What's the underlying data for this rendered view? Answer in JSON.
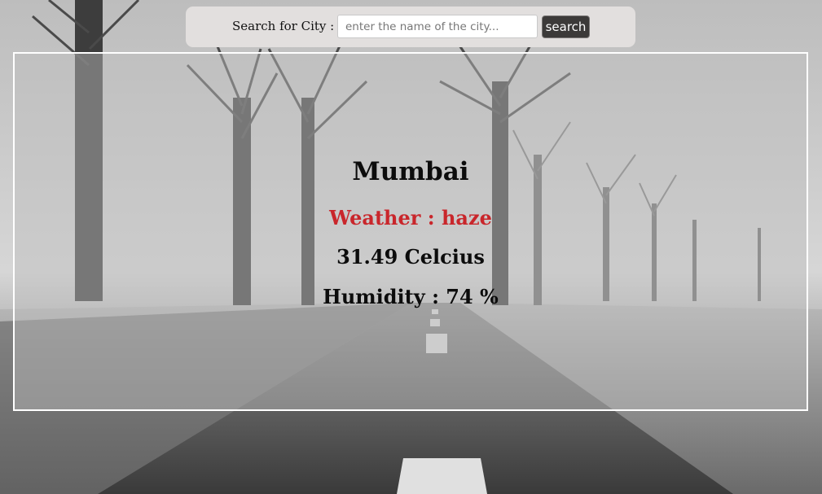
{
  "search": {
    "label": "Search for City :",
    "placeholder": "enter the name of the city...",
    "value": "",
    "button_label": "search"
  },
  "weather_card": {
    "city": "Mumbai",
    "weather": "Weather : haze",
    "temperature": "31.49 Celcius",
    "humidity": "Humidity : 74 %"
  },
  "colors": {
    "weather_text": "#c9262b",
    "search_bar_bg": "#e2dfde",
    "button_bg": "#3c3a39",
    "card_border": "#ffffff"
  }
}
